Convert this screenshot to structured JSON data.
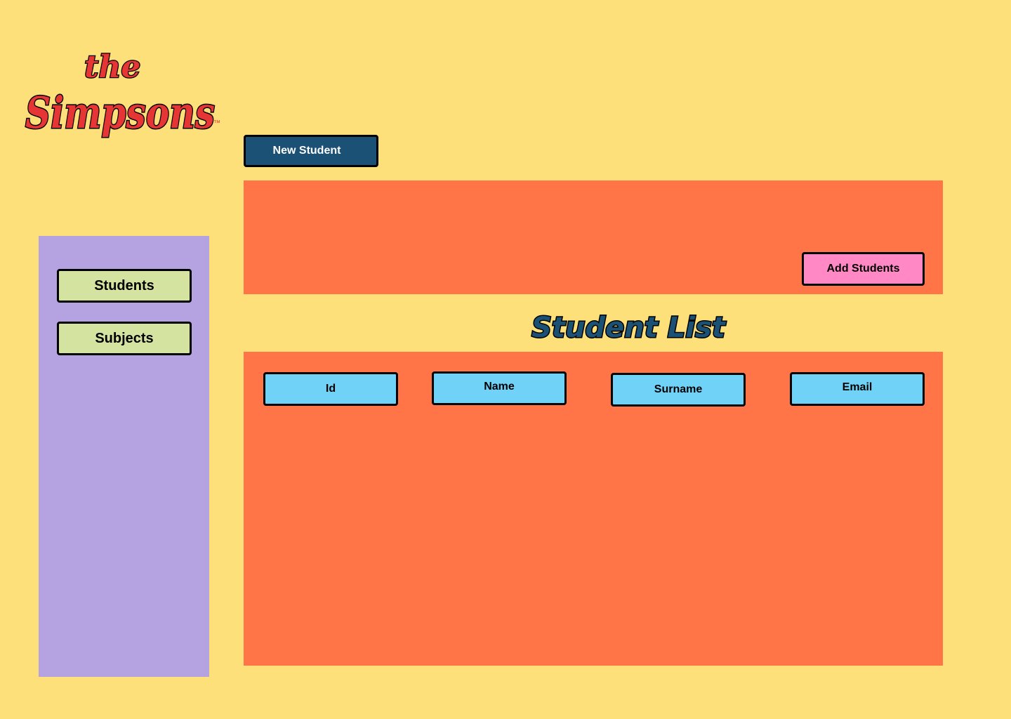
{
  "logo": {
    "line1": "the",
    "line2": "Simpsons",
    "tm": "™",
    "color": "#E53535"
  },
  "toolbar": {
    "new_student_label": "New Student"
  },
  "top_panel": {
    "add_students_label": "Add Students"
  },
  "sidebar": {
    "items": [
      {
        "label": "Students"
      },
      {
        "label": "Subjects"
      }
    ]
  },
  "student_list": {
    "title": "Student List",
    "columns": [
      {
        "label": "Id"
      },
      {
        "label": "Name"
      },
      {
        "label": "Surname"
      },
      {
        "label": "Email"
      }
    ],
    "rows": []
  },
  "colors": {
    "background": "#FDE07A",
    "panel": "#FF7547",
    "sidebar": "#B4A2E1",
    "nav_button": "#D5E3A1",
    "primary_button": "#1B5175",
    "add_button": "#FF88C5",
    "column_header": "#6FD2F6",
    "title": "#1B5175"
  }
}
